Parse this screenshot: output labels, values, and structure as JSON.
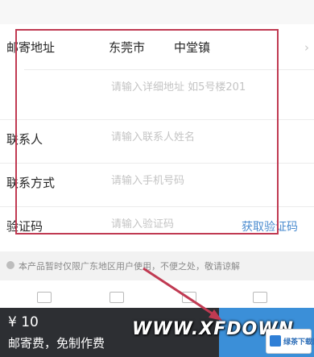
{
  "form": {
    "address_label": "邮寄地址",
    "city": "东莞市",
    "town": "中堂镇",
    "address_placeholder": "请输入详细地址 如5号楼201",
    "contact_label": "联系人",
    "contact_placeholder": "请输入联系人姓名",
    "phone_label": "联系方式",
    "phone_placeholder": "请输入手机号码",
    "code_label": "验证码",
    "code_placeholder": "请输入验证码",
    "get_code_button": "获取验证码"
  },
  "notice": "本产品暂时仅限广东地区用户使用，不便之处，敬请谅解",
  "bottom": {
    "price": "¥ 10",
    "fee_note": "邮寄费，免制作费"
  },
  "watermark": "WWW.XFDOWN",
  "badge": "绿茶下载网",
  "colors": {
    "highlight": "#c03a52",
    "accent": "#3b8fd8",
    "link": "#4a8bcf",
    "bottom_bar": "#2d2f33"
  }
}
